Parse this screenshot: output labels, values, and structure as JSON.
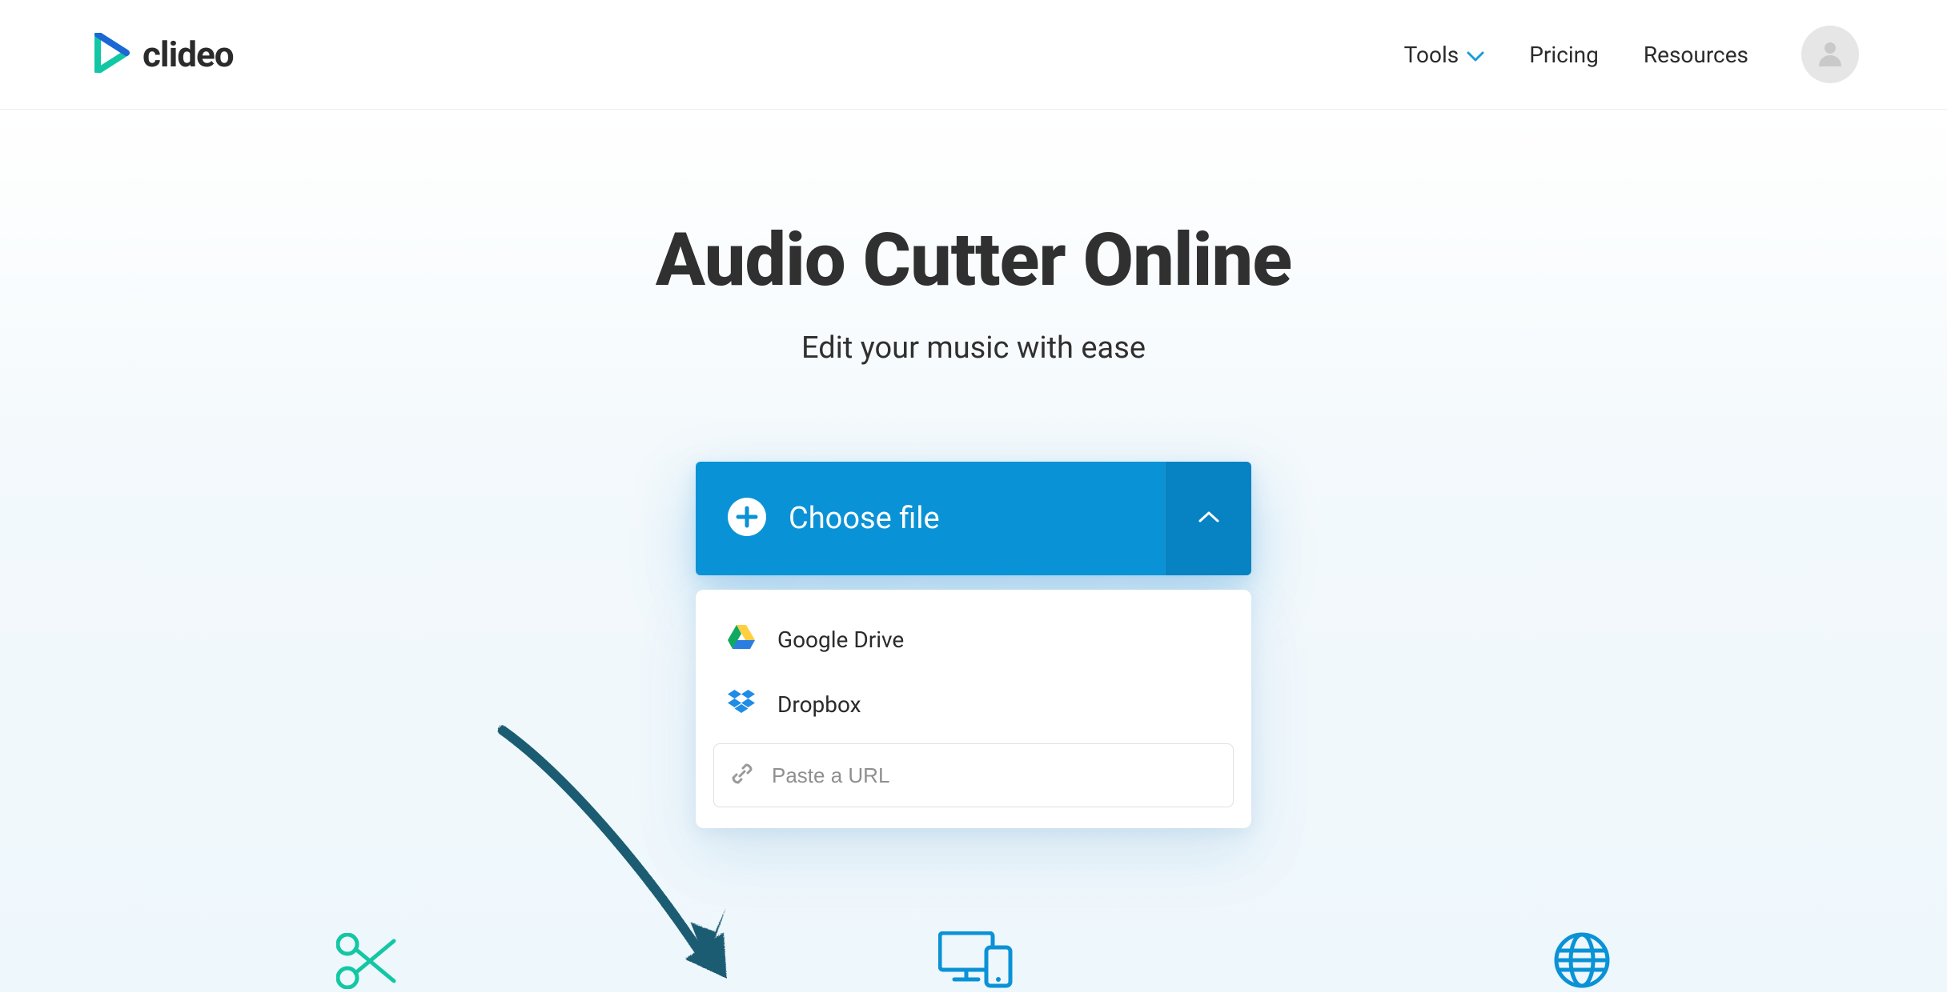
{
  "brand": {
    "name": "clideo"
  },
  "nav": {
    "tools": "Tools",
    "pricing": "Pricing",
    "resources": "Resources"
  },
  "hero": {
    "title": "Audio Cutter Online",
    "subtitle": "Edit your music with ease"
  },
  "uploader": {
    "choose_label": "Choose file",
    "options": {
      "gdrive": "Google Drive",
      "dropbox": "Dropbox"
    },
    "url_placeholder": "Paste a URL"
  }
}
